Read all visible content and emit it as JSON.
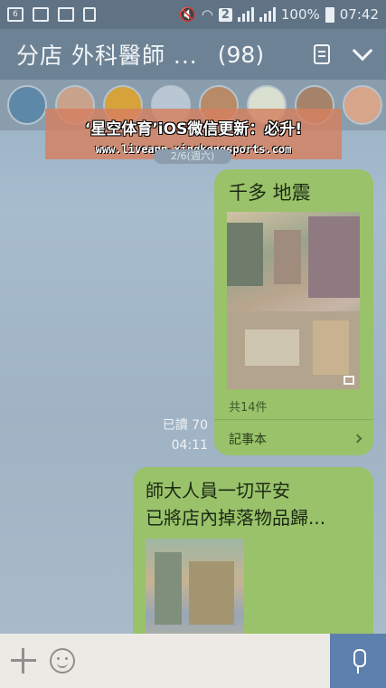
{
  "status_bar": {
    "battery": "100%",
    "time": "07:42",
    "sim_badge": "2",
    "calendar_day": "6"
  },
  "header": {
    "title": "分店 外科醫師 ...",
    "member_count": "(98)"
  },
  "watermark": {
    "title": "‘星空体育’iOS微信更新：必升!",
    "url": "www.liveapp-xingkongsports.com"
  },
  "date_pill": "2/6(週六)",
  "messages": [
    {
      "text": "千多  地震",
      "album_count": "共14件",
      "album_label": "記事本",
      "read": "已讀 70",
      "time": "04:11"
    },
    {
      "line1": "師大人員一切平安",
      "line2": "已將店內掉落物品歸..."
    }
  ],
  "input": {
    "placeholder": ""
  },
  "colors": {
    "bubble": "#99c26a",
    "header": "#6d8294",
    "mic": "#5d7fae"
  }
}
